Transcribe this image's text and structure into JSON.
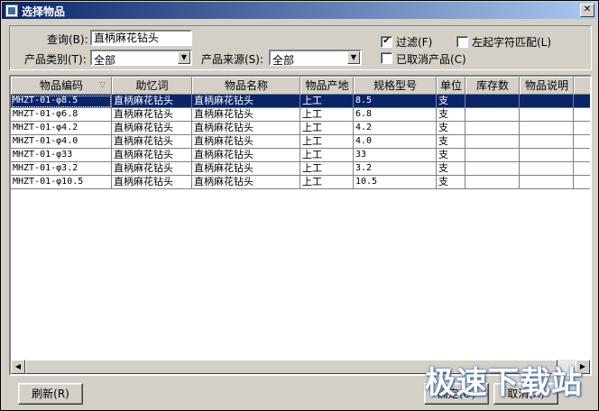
{
  "window": {
    "title": "选择物品",
    "close_glyph": "✕"
  },
  "filters": {
    "query_label": "查询(B):",
    "query_value": "直柄麻花钻头",
    "category_label": "产品类别(T):",
    "category_value": "全部",
    "source_label": "产品来源(S):",
    "source_value": "全部",
    "filter_label": "过滤(F)",
    "filter_checked": true,
    "leftmatch_label": "左起字符匹配(L)",
    "leftmatch_checked": false,
    "cancelled_label": "已取消产品(C)",
    "cancelled_checked": false
  },
  "table": {
    "headers": [
      "物品编码",
      "助忆词",
      "物品名称",
      "物品产地",
      "规格型号",
      "单位",
      "库存数",
      "物品说明"
    ],
    "sort_glyph": "▽",
    "rows": [
      [
        "MHZT-01-φ8.5",
        "直柄麻花钻头",
        "直柄麻花钻头",
        "上工",
        "8.5",
        "支",
        "",
        ""
      ],
      [
        "MHZT-01-φ6.8",
        "直柄麻花钻头",
        "直柄麻花钻头",
        "上工",
        "6.8",
        "支",
        "",
        ""
      ],
      [
        "MHZT-01-φ4.2",
        "直柄麻花钻头",
        "直柄麻花钻头",
        "上工",
        "4.2",
        "支",
        "",
        ""
      ],
      [
        "MHZT-01-φ4.0",
        "直柄麻花钻头",
        "直柄麻花钻头",
        "上工",
        "4.0",
        "支",
        "",
        ""
      ],
      [
        "MHZT-01-φ33",
        "直柄麻花钻头",
        "直柄麻花钻头",
        "上工",
        "33",
        "支",
        "",
        ""
      ],
      [
        "MHZT-01-φ3.2",
        "直柄麻花钻头",
        "直柄麻花钻头",
        "上工",
        "3.2",
        "支",
        "",
        ""
      ],
      [
        "MHZT-01-φ10.5",
        "直柄麻花钻头",
        "直柄麻花钻头",
        "上工",
        "10.5",
        "支",
        "",
        ""
      ]
    ]
  },
  "buttons": {
    "refresh": "刷新(R)",
    "ok": "确定(O)",
    "cancel": "取消(X)"
  },
  "watermark": "极速下载站"
}
